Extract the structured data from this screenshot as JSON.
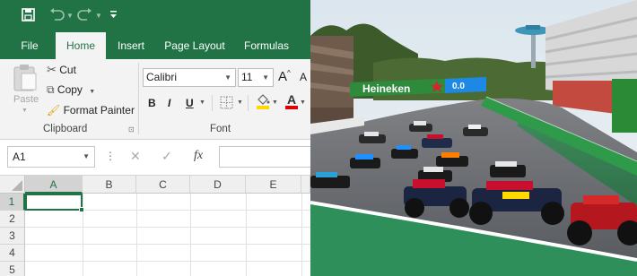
{
  "excel": {
    "quick_access": {
      "save_icon": "save-icon",
      "undo_icon": "undo-icon",
      "redo_icon": "redo-icon",
      "customize_icon": "customize-icon"
    },
    "tabs": [
      {
        "label": "File",
        "active": false
      },
      {
        "label": "Home",
        "active": true
      },
      {
        "label": "Insert",
        "active": false
      },
      {
        "label": "Page Layout",
        "active": false
      },
      {
        "label": "Formulas",
        "active": false
      }
    ],
    "clipboard": {
      "paste_label": "Paste",
      "cut_label": "Cut",
      "copy_label": "Copy",
      "format_painter_label": "Format Painter",
      "group_label": "Clipboard"
    },
    "font": {
      "family_value": "Calibri",
      "size_value": "11",
      "grow_label": "A",
      "shrink_label": "A",
      "bold_label": "B",
      "italic_label": "I",
      "underline_label": "U",
      "font_color_label": "A",
      "group_label": "Font"
    },
    "formula_bar": {
      "name_box_value": "A1",
      "fx_label": "fx",
      "cancel_icon": "cancel-icon",
      "enter_icon": "checkmark-icon",
      "formula_value": ""
    },
    "grid": {
      "columns": [
        "A",
        "B",
        "C",
        "D",
        "E"
      ],
      "rows": [
        "1",
        "2",
        "3",
        "4",
        "5"
      ],
      "active_cell": "A1"
    },
    "colors": {
      "accent": "#217346",
      "ribbon_bg": "#f3f3f3",
      "highlight_yellow": "#ffd800",
      "font_red": "#e00000"
    }
  },
  "photo": {
    "banner_brand": "Heineken",
    "banner_tagline": "0.0",
    "banner_colors": {
      "green": "#2e8b3c",
      "red": "#d8232a",
      "blue": "#1e88e5"
    }
  }
}
